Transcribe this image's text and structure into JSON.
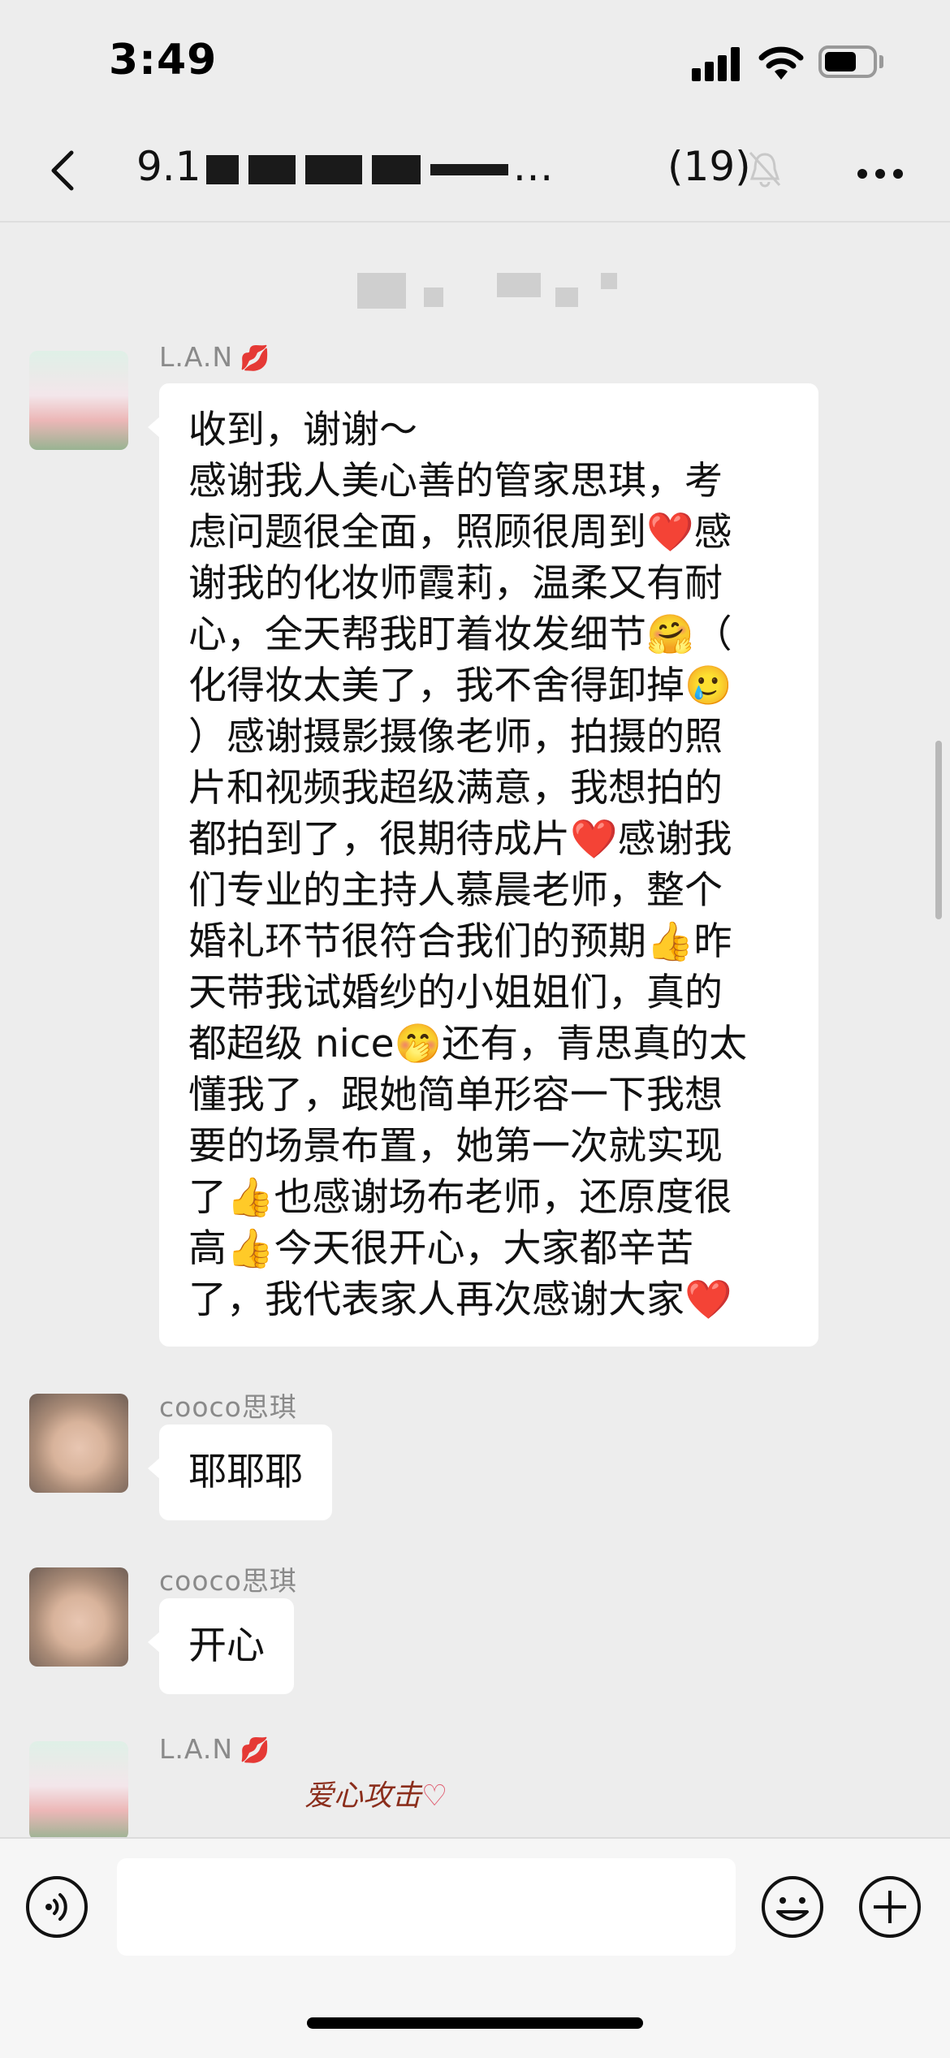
{
  "status_bar": {
    "time": "3:49"
  },
  "header": {
    "title_prefix": "9.1",
    "title_suffix": "…",
    "member_count": "(19)"
  },
  "messages": [
    {
      "sender": "L.A.N",
      "sender_emoji": "💋",
      "lines": [
        "收到，谢谢～",
        "感谢我人美心善的管家思琪，考",
        "虑问题很全面，照顾很周到❤️感",
        "谢我的化妆师霞莉，温柔又有耐",
        "心，全天帮我盯着妆发细节🤗（",
        "化得妆太美了，我不舍得卸掉🥲",
        "）感谢摄影摄像老师，拍摄的照",
        "片和视频我超级满意，我想拍的",
        "都拍到了，很期待成片❤️感谢我",
        "们专业的主持人慕晨老师，整个",
        "婚礼环节很符合我们的预期👍昨",
        "天带我试婚纱的小姐姐们，真的",
        "都超级 nice🤭还有，青思真的太",
        "懂我了，跟她简单形容一下我想",
        "要的场景布置，她第一次就实现",
        "了👍也感谢场布老师，还原度很",
        "高👍今天很开心，大家都辛苦",
        "了，我代表家人再次感谢大家❤️"
      ]
    },
    {
      "sender": "cooco思琪",
      "text": "耶耶耶"
    },
    {
      "sender": "cooco思琪",
      "text": "开心"
    },
    {
      "sender": "L.A.N",
      "sender_emoji": "💋",
      "sticker_text": "爱心攻击",
      "sticker_heart": "♡"
    }
  ],
  "colors": {
    "background": "#ededed",
    "bubble": "#ffffff",
    "sender_name": "#8a8a8a"
  },
  "icons": [
    "back-icon",
    "mute-icon",
    "more-icon",
    "voice-icon",
    "emoji-icon",
    "plus-icon"
  ]
}
